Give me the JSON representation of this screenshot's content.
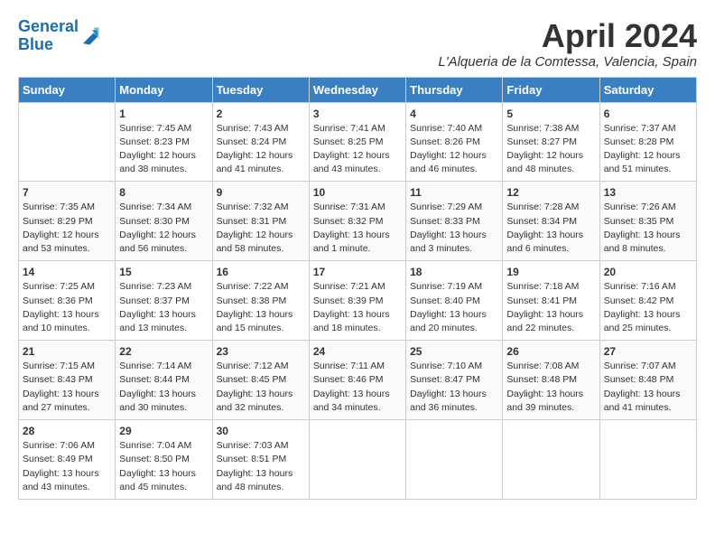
{
  "header": {
    "logo_line1": "General",
    "logo_line2": "Blue",
    "month_title": "April 2024",
    "location": "L'Alqueria de la Comtessa, Valencia, Spain"
  },
  "weekdays": [
    "Sunday",
    "Monday",
    "Tuesday",
    "Wednesday",
    "Thursday",
    "Friday",
    "Saturday"
  ],
  "weeks": [
    [
      {
        "day": "",
        "info": ""
      },
      {
        "day": "1",
        "info": "Sunrise: 7:45 AM\nSunset: 8:23 PM\nDaylight: 12 hours\nand 38 minutes."
      },
      {
        "day": "2",
        "info": "Sunrise: 7:43 AM\nSunset: 8:24 PM\nDaylight: 12 hours\nand 41 minutes."
      },
      {
        "day": "3",
        "info": "Sunrise: 7:41 AM\nSunset: 8:25 PM\nDaylight: 12 hours\nand 43 minutes."
      },
      {
        "day": "4",
        "info": "Sunrise: 7:40 AM\nSunset: 8:26 PM\nDaylight: 12 hours\nand 46 minutes."
      },
      {
        "day": "5",
        "info": "Sunrise: 7:38 AM\nSunset: 8:27 PM\nDaylight: 12 hours\nand 48 minutes."
      },
      {
        "day": "6",
        "info": "Sunrise: 7:37 AM\nSunset: 8:28 PM\nDaylight: 12 hours\nand 51 minutes."
      }
    ],
    [
      {
        "day": "7",
        "info": "Sunrise: 7:35 AM\nSunset: 8:29 PM\nDaylight: 12 hours\nand 53 minutes."
      },
      {
        "day": "8",
        "info": "Sunrise: 7:34 AM\nSunset: 8:30 PM\nDaylight: 12 hours\nand 56 minutes."
      },
      {
        "day": "9",
        "info": "Sunrise: 7:32 AM\nSunset: 8:31 PM\nDaylight: 12 hours\nand 58 minutes."
      },
      {
        "day": "10",
        "info": "Sunrise: 7:31 AM\nSunset: 8:32 PM\nDaylight: 13 hours\nand 1 minute."
      },
      {
        "day": "11",
        "info": "Sunrise: 7:29 AM\nSunset: 8:33 PM\nDaylight: 13 hours\nand 3 minutes."
      },
      {
        "day": "12",
        "info": "Sunrise: 7:28 AM\nSunset: 8:34 PM\nDaylight: 13 hours\nand 6 minutes."
      },
      {
        "day": "13",
        "info": "Sunrise: 7:26 AM\nSunset: 8:35 PM\nDaylight: 13 hours\nand 8 minutes."
      }
    ],
    [
      {
        "day": "14",
        "info": "Sunrise: 7:25 AM\nSunset: 8:36 PM\nDaylight: 13 hours\nand 10 minutes."
      },
      {
        "day": "15",
        "info": "Sunrise: 7:23 AM\nSunset: 8:37 PM\nDaylight: 13 hours\nand 13 minutes."
      },
      {
        "day": "16",
        "info": "Sunrise: 7:22 AM\nSunset: 8:38 PM\nDaylight: 13 hours\nand 15 minutes."
      },
      {
        "day": "17",
        "info": "Sunrise: 7:21 AM\nSunset: 8:39 PM\nDaylight: 13 hours\nand 18 minutes."
      },
      {
        "day": "18",
        "info": "Sunrise: 7:19 AM\nSunset: 8:40 PM\nDaylight: 13 hours\nand 20 minutes."
      },
      {
        "day": "19",
        "info": "Sunrise: 7:18 AM\nSunset: 8:41 PM\nDaylight: 13 hours\nand 22 minutes."
      },
      {
        "day": "20",
        "info": "Sunrise: 7:16 AM\nSunset: 8:42 PM\nDaylight: 13 hours\nand 25 minutes."
      }
    ],
    [
      {
        "day": "21",
        "info": "Sunrise: 7:15 AM\nSunset: 8:43 PM\nDaylight: 13 hours\nand 27 minutes."
      },
      {
        "day": "22",
        "info": "Sunrise: 7:14 AM\nSunset: 8:44 PM\nDaylight: 13 hours\nand 30 minutes."
      },
      {
        "day": "23",
        "info": "Sunrise: 7:12 AM\nSunset: 8:45 PM\nDaylight: 13 hours\nand 32 minutes."
      },
      {
        "day": "24",
        "info": "Sunrise: 7:11 AM\nSunset: 8:46 PM\nDaylight: 13 hours\nand 34 minutes."
      },
      {
        "day": "25",
        "info": "Sunrise: 7:10 AM\nSunset: 8:47 PM\nDaylight: 13 hours\nand 36 minutes."
      },
      {
        "day": "26",
        "info": "Sunrise: 7:08 AM\nSunset: 8:48 PM\nDaylight: 13 hours\nand 39 minutes."
      },
      {
        "day": "27",
        "info": "Sunrise: 7:07 AM\nSunset: 8:48 PM\nDaylight: 13 hours\nand 41 minutes."
      }
    ],
    [
      {
        "day": "28",
        "info": "Sunrise: 7:06 AM\nSunset: 8:49 PM\nDaylight: 13 hours\nand 43 minutes."
      },
      {
        "day": "29",
        "info": "Sunrise: 7:04 AM\nSunset: 8:50 PM\nDaylight: 13 hours\nand 45 minutes."
      },
      {
        "day": "30",
        "info": "Sunrise: 7:03 AM\nSunset: 8:51 PM\nDaylight: 13 hours\nand 48 minutes."
      },
      {
        "day": "",
        "info": ""
      },
      {
        "day": "",
        "info": ""
      },
      {
        "day": "",
        "info": ""
      },
      {
        "day": "",
        "info": ""
      }
    ]
  ]
}
